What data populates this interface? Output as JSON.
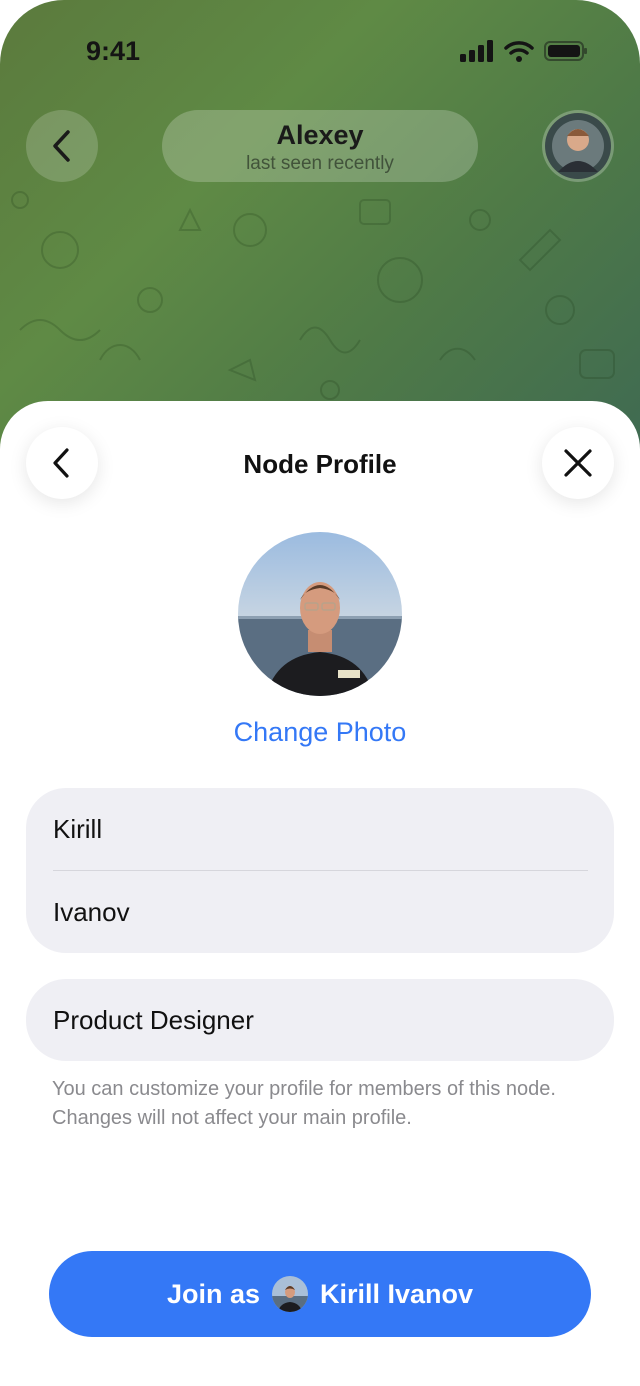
{
  "status_bar": {
    "time": "9:41"
  },
  "chat_header": {
    "contact_name": "Alexey",
    "contact_status": "last seen recently"
  },
  "sheet": {
    "title": "Node Profile",
    "change_photo_label": "Change Photo",
    "first_name": "Kirill",
    "last_name": "Ivanov",
    "job_title": "Product Designer",
    "hint": "You can customize your profile for members of this node. Changes will not affect your main profile.",
    "join_prefix": "Join as",
    "join_name": "Kirill Ivanov"
  },
  "colors": {
    "accent": "#3478f6",
    "field_background": "#efeff4",
    "hint_text": "#8a8a8e",
    "chat_background": "#5f8a45"
  },
  "icons": [
    "chevron-left-icon",
    "close-icon",
    "cellular-signal-icon",
    "wifi-icon",
    "battery-icon"
  ]
}
